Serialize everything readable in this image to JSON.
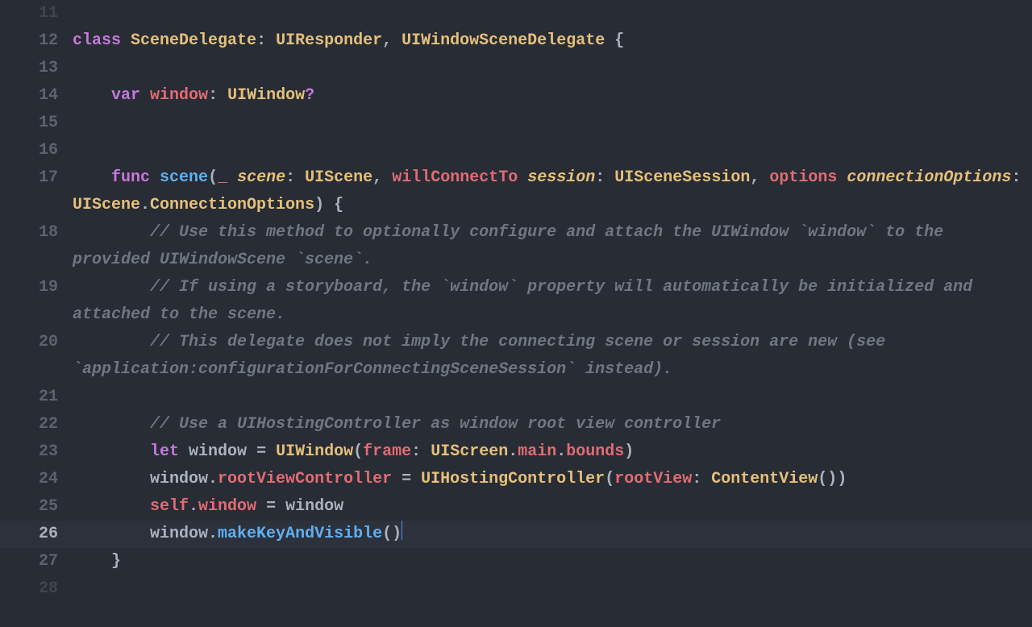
{
  "colors": {
    "background": "#282c34",
    "current_line": "#2c313c",
    "gutter": "#5c6370",
    "gutter_dim": "#40454f",
    "keyword": "#c678dd",
    "self": "#e06c75",
    "type": "#e5c07b",
    "function": "#61afef",
    "comment": "#6f7784",
    "property": "#e06c75",
    "plain": "#abb2bf"
  },
  "line_numbers": {
    "l11": "11",
    "l12": "12",
    "l13": "13",
    "l14": "14",
    "l15": "15",
    "l16": "16",
    "l17": "17",
    "l18": "18",
    "l19": "19",
    "l20": "20",
    "l21": "21",
    "l22": "22",
    "l23": "23",
    "l24": "24",
    "l25": "25",
    "l26": "26",
    "l27": "27",
    "l28": "28"
  },
  "tokens": {
    "class_kw": "class",
    "SceneDelegate": "SceneDelegate",
    "colon": ":",
    "UIResponder": "UIResponder",
    "comma": ",",
    "UIWindowSceneDelegate": "UIWindowSceneDelegate",
    "lbrace": "{",
    "rbrace": "}",
    "var_kw": "var",
    "window": "window",
    "UIWindow": "UIWindow",
    "qmark": "?",
    "func_kw": "func",
    "scene_fn": "scene",
    "lparen": "(",
    "rparen": ")",
    "underscore": "_",
    "scene_arg": "scene",
    "UIScene": "UIScene",
    "willConnectTo": "willConnectTo",
    "session": "session",
    "UISceneSession": "UISceneSession",
    "options": "options",
    "connectionOptions": "connectionOptions",
    "ConnectionOptions": "ConnectionOptions",
    "dot": ".",
    "cm18a": "// Use this method to optionally configure and attach the UIWindow `window` to the provided UIWindowScene `scene`.",
    "cm19a": "// If using a storyboard, the `window` property will automatically be initialized and attached to the scene.",
    "cm20a": "// This delegate does not imply the connecting scene or session are new (see `application:configurationForConnectingSceneSession` instead).",
    "cm22": "// Use a UIHostingController as window root view controller",
    "let_kw": "let",
    "eq": "=",
    "frame": "frame",
    "UIScreen": "UIScreen",
    "main": "main",
    "bounds": "bounds",
    "rootViewController": "rootViewController",
    "UIHostingController": "UIHostingController",
    "rootView": "rootView",
    "ContentView": "ContentView",
    "self_kw": "self",
    "makeKeyAndVisible": "makeKeyAndVisible"
  },
  "current_line": 26,
  "cursor_after": "window.makeKeyAndVisible()"
}
